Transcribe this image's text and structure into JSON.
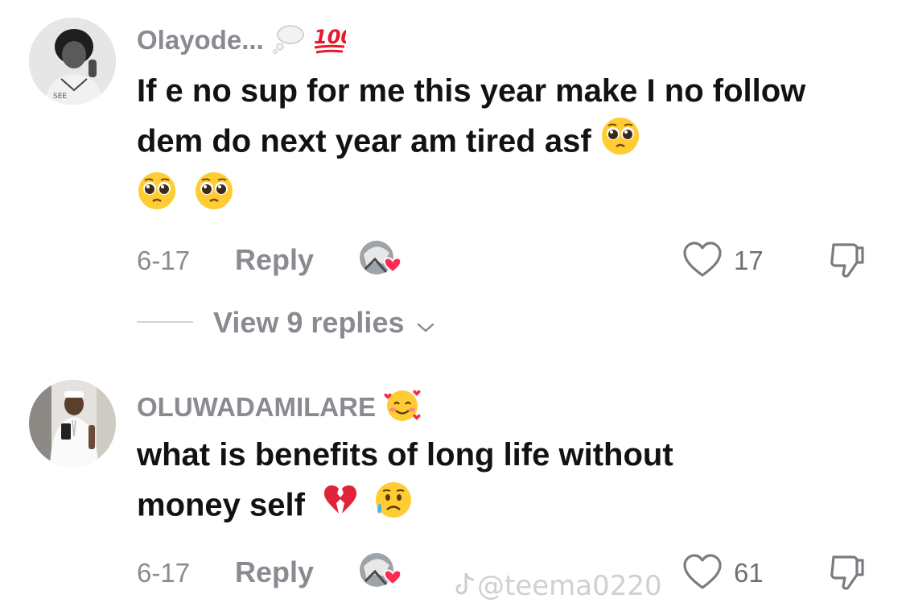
{
  "comments": [
    {
      "username": "Olayode...",
      "username_emojis": [
        "thought-balloon",
        "hundred-points"
      ],
      "text": "If e no sup for me this year make I no follow dem do next year am tired asf",
      "text_emojis": [
        "pleading-face",
        "pleading-face",
        "pleading-face"
      ],
      "date": "6-17",
      "reply_label": "Reply",
      "likes": "17",
      "view_replies_label": "View 9 replies",
      "avatar_badge": "SEE"
    },
    {
      "username": "OLUWADAMILARE",
      "username_emojis": [
        "smiling-face-with-hearts"
      ],
      "text_line1": "what is benefits of long life without",
      "text_line2": "money self",
      "text_emojis": [
        "broken-heart",
        "sad-but-relieved-face"
      ],
      "date": "6-17",
      "reply_label": "Reply",
      "likes": "61"
    }
  ],
  "watermark": "@teema0220",
  "colors": {
    "muted": "#8a8b91",
    "text": "#121212",
    "heart": "#fe2c55",
    "emoji_yellow": "#ffcc33"
  }
}
